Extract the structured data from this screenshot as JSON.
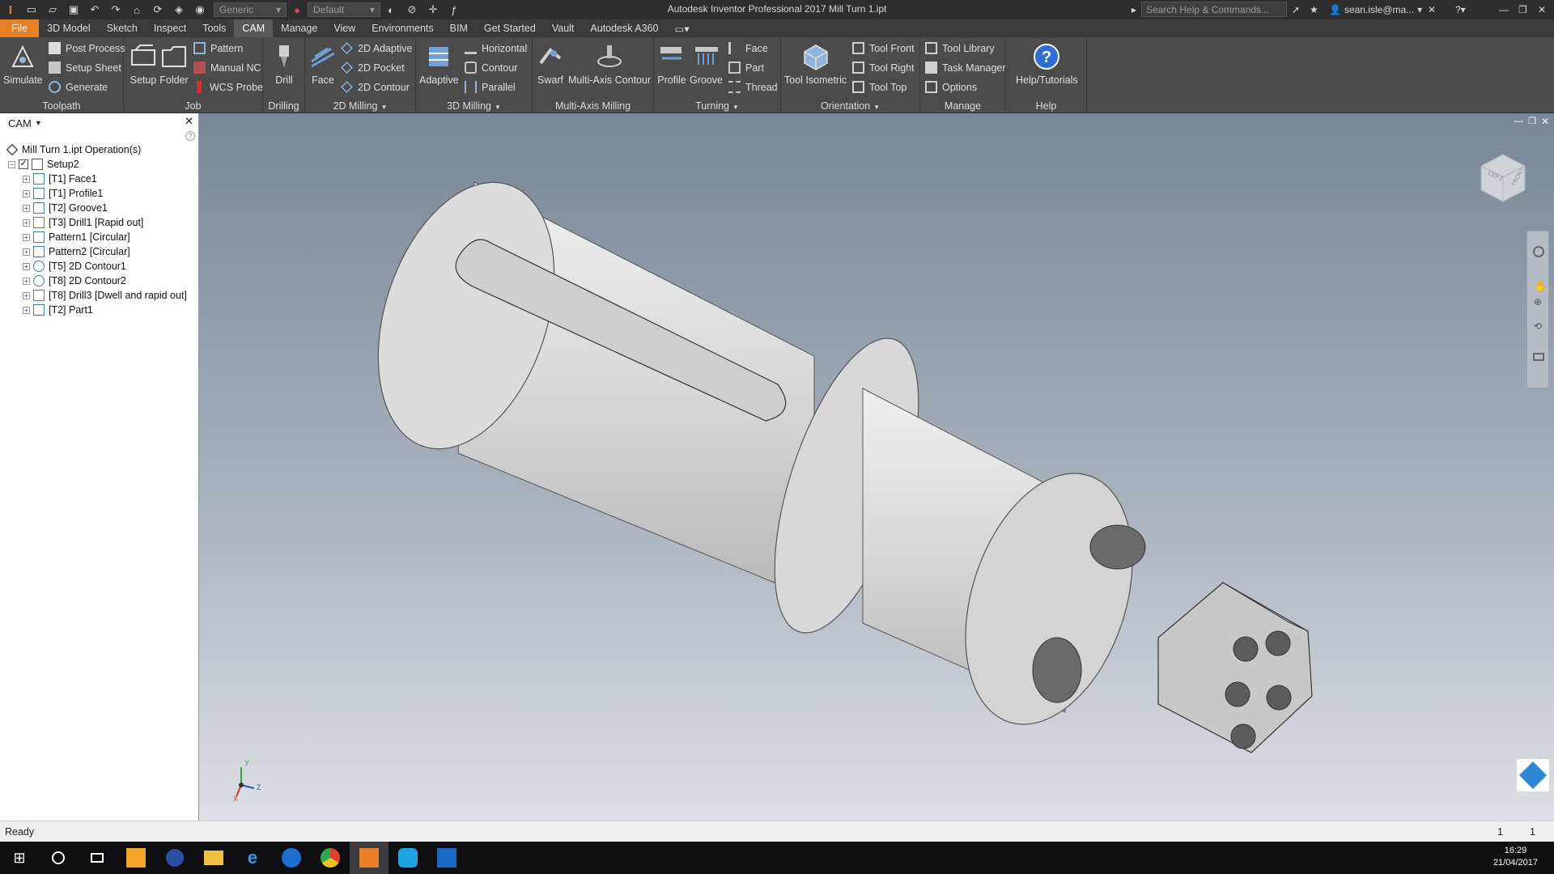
{
  "window": {
    "title": "Autodesk Inventor Professional 2017    Mill Turn 1.ipt",
    "quick_access": {
      "appearance_select": "Generic",
      "style_select": "Default"
    },
    "search_placeholder": "Search Help & Commands...",
    "user": "sean.isle@ma..."
  },
  "menu_tabs": [
    "File",
    "3D Model",
    "Sketch",
    "Inspect",
    "Tools",
    "CAM",
    "Manage",
    "View",
    "Environments",
    "BIM",
    "Get Started",
    "Vault",
    "Autodesk A360"
  ],
  "active_tab": "CAM",
  "ribbon": {
    "toolpath": {
      "title": "Toolpath",
      "simulate": "Simulate",
      "post_process": "Post Process",
      "setup_sheet": "Setup Sheet",
      "generate": "Generate"
    },
    "job": {
      "title": "Job",
      "setup": "Setup",
      "folder": "Folder",
      "pattern": "Pattern",
      "manual_nc": "Manual NC",
      "wcs_probe": "WCS Probe"
    },
    "drilling": {
      "title": "Drilling",
      "drill": "Drill"
    },
    "milling_2d": {
      "title": "2D Milling",
      "face": "Face",
      "adaptive_2d": "2D Adaptive",
      "pocket_2d": "2D Pocket",
      "contour_2d": "2D Contour"
    },
    "milling_3d": {
      "title": "3D Milling",
      "adaptive": "Adaptive",
      "horizontal": "Horizontal",
      "contour": "Contour",
      "parallel": "Parallel"
    },
    "multi_axis": {
      "title": "Multi-Axis Milling",
      "swarf": "Swarf",
      "multi_axis_contour": "Multi-Axis Contour"
    },
    "turning": {
      "title": "Turning",
      "profile": "Profile",
      "groove": "Groove",
      "face": "Face",
      "part": "Part",
      "thread": "Thread"
    },
    "orientation": {
      "title": "Orientation",
      "tool_isometric": "Tool Isometric",
      "tool_front": "Tool Front",
      "tool_right": "Tool Right",
      "tool_top": "Tool Top"
    },
    "manage": {
      "title": "Manage",
      "tool_library": "Tool Library",
      "task_manager": "Task Manager",
      "options": "Options"
    },
    "help": {
      "title": "Help",
      "help_tutorials": "Help/Tutorials"
    }
  },
  "browser": {
    "title": "CAM",
    "root": "Mill Turn 1.ipt Operation(s)",
    "setup": "Setup2",
    "operations": [
      "[T1] Face1",
      "[T1] Profile1",
      "[T2] Groove1",
      "[T3] Drill1 [Rapid out]",
      "Pattern1 [Circular]",
      "Pattern2 [Circular]",
      "[T5] 2D Contour1",
      "[T8] 2D Contour2",
      "[T8] Drill3 [Dwell and rapid out]",
      "[T2] Part1"
    ]
  },
  "viewcube": {
    "face_left": "LEFT",
    "face_right": "FRONT"
  },
  "triad": {
    "x": "X",
    "y": "Y",
    "z": "Z"
  },
  "status": {
    "text": "Ready",
    "count1": "1",
    "count2": "1"
  },
  "taskbar": {
    "time": "16:29",
    "date": "21/04/2017"
  },
  "colors": {
    "accent": "#e77f24",
    "ribbon": "#4b4b4b",
    "viewport_top": "#7a8696",
    "viewport_bottom": "#dde0e4"
  }
}
